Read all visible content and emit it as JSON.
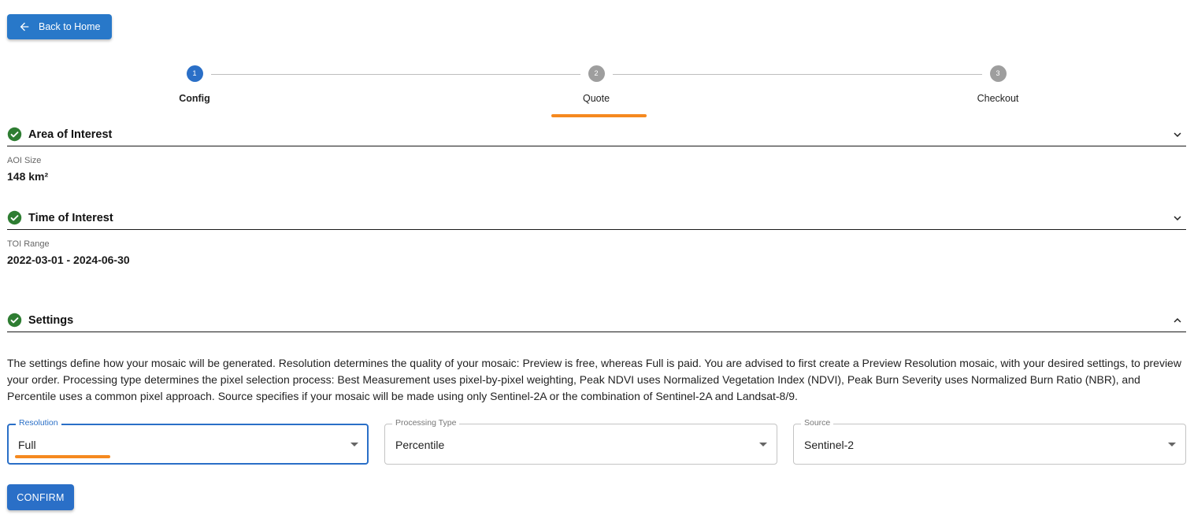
{
  "back_button": {
    "label": "Back to Home",
    "icon": "arrow-left-icon"
  },
  "stepper": {
    "steps": [
      {
        "number": "1",
        "label": "Config",
        "state": "active"
      },
      {
        "number": "2",
        "label": "Quote",
        "state": "inactive"
      },
      {
        "number": "3",
        "label": "Checkout",
        "state": "inactive"
      }
    ]
  },
  "sections": {
    "aoi": {
      "title": "Area of Interest",
      "expanded": false,
      "field_label": "AOI Size",
      "field_value": "148 km²"
    },
    "toi": {
      "title": "Time of Interest",
      "expanded": false,
      "field_label": "TOI Range",
      "field_value": "2022-03-01 - 2024-06-30"
    },
    "settings": {
      "title": "Settings",
      "expanded": true,
      "description": "The settings define how your mosaic will be generated. Resolution determines the quality of your mosaic: Preview is free, whereas Full is paid. You are advised to first create a Preview Resolution mosaic, with your desired settings, to preview your order. Processing type determines the pixel selection process: Best Measurement uses pixel-by-pixel weighting, Peak NDVI uses Normalized Vegetation Index (NDVI), Peak Burn Severity uses Normalized Burn Ratio (NBR), and Percentile uses a common pixel approach. Source specifies if your mosaic will be made using only Sentinel-2A or the combination of Sentinel-2A and Landsat-8/9.",
      "fields": {
        "resolution": {
          "label": "Resolution",
          "value": "Full"
        },
        "processing_type": {
          "label": "Processing Type",
          "value": "Percentile"
        },
        "source": {
          "label": "Source",
          "value": "Sentinel-2"
        }
      },
      "confirm_label": "CONFIRM"
    }
  },
  "colors": {
    "primary": "#2a6fc7",
    "step_inactive": "#9e9e9e",
    "success": "#2e7d32",
    "annotation": "#f5891f"
  }
}
